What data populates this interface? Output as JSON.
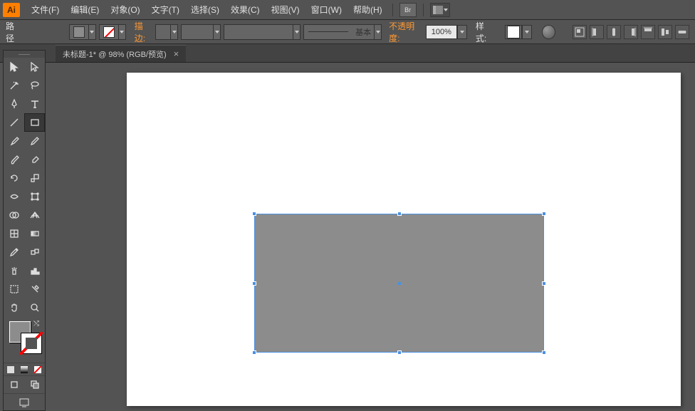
{
  "app": {
    "icon_text": "Ai"
  },
  "menu": {
    "items": [
      "文件(F)",
      "编辑(E)",
      "对象(O)",
      "文字(T)",
      "选择(S)",
      "效果(C)",
      "视图(V)",
      "窗口(W)",
      "帮助(H)"
    ],
    "bridge_label": "Br"
  },
  "control": {
    "selection_label": "路径",
    "stroke_label": "描边:",
    "brush_label": "基本",
    "opacity_label": "不透明度:",
    "opacity_value": "100%",
    "style_label": "样式:",
    "colors": {
      "fill": "#8c8c8c",
      "stroke": "none"
    }
  },
  "tab": {
    "title": "未标题-1* @ 98% (RGB/预览)"
  },
  "artboard": {
    "shape": {
      "type": "rectangle",
      "fill": "#8c8c8c",
      "selected": true
    }
  },
  "tools": [
    [
      "selection",
      "direct-selection"
    ],
    [
      "magic-wand",
      "lasso"
    ],
    [
      "pen",
      "type"
    ],
    [
      "line",
      "rectangle"
    ],
    [
      "paintbrush",
      "pencil"
    ],
    [
      "blob-brush",
      "eraser"
    ],
    [
      "rotate",
      "scale"
    ],
    [
      "width",
      "free-transform"
    ],
    [
      "shape-builder",
      "perspective"
    ],
    [
      "mesh",
      "gradient"
    ],
    [
      "eyedropper",
      "blend"
    ],
    [
      "symbol-sprayer",
      "column-graph"
    ],
    [
      "artboard",
      "slice"
    ],
    [
      "hand",
      "zoom"
    ]
  ]
}
